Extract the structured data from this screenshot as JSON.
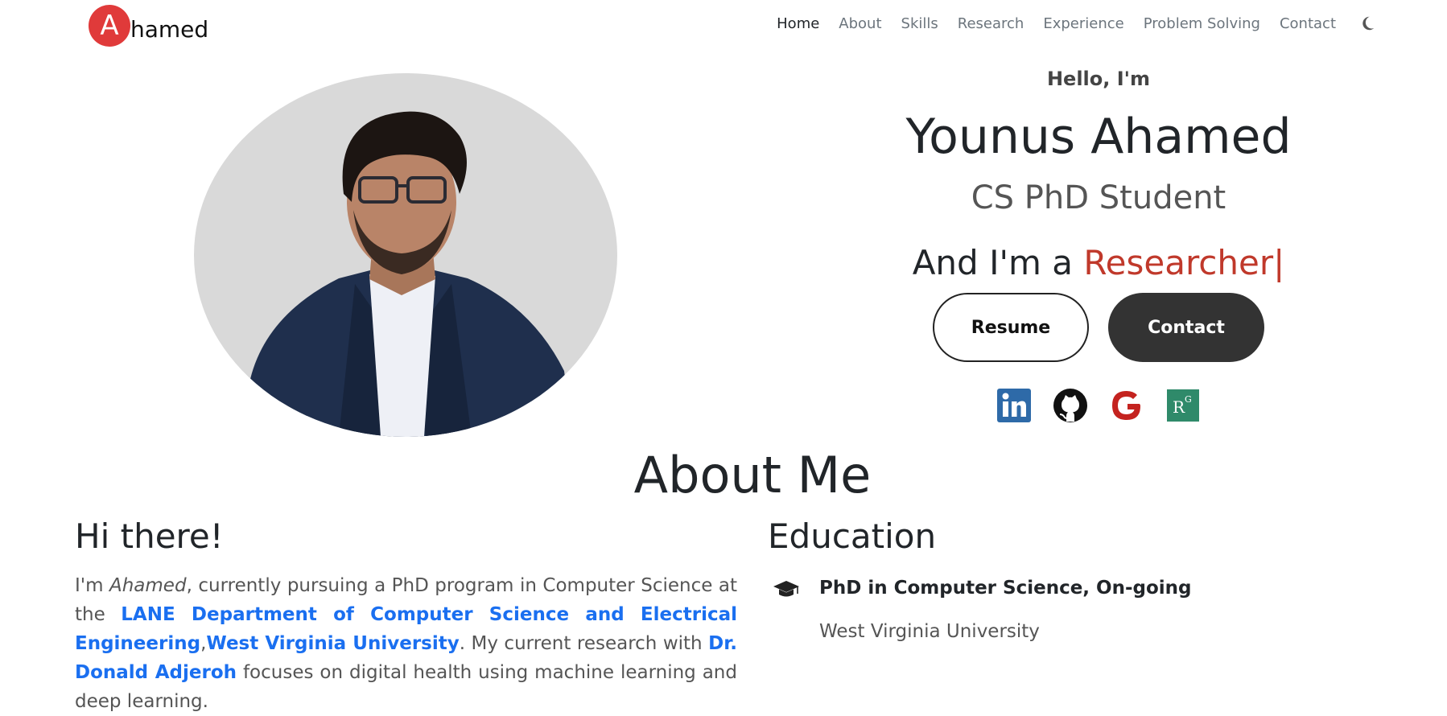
{
  "nav": {
    "brand_initial": "A",
    "brand_text": "hamed",
    "links": [
      "Home",
      "About",
      "Skills",
      "Research",
      "Experience",
      "Problem Solving",
      "Contact"
    ],
    "active": "Home",
    "theme_icon": "moon-icon"
  },
  "hero": {
    "greeting": "Hello, I'm",
    "name": "Younus Ahamed",
    "role": "CS PhD Student",
    "typed_prefix": "And I'm a ",
    "typed_word": "Researcher|",
    "resume_label": "Resume",
    "contact_label": "Contact",
    "socials": [
      "linkedin-icon",
      "github-icon",
      "google-scholar-icon",
      "researchgate-icon"
    ],
    "researchgate_mark": "RG"
  },
  "about": {
    "title": "About Me",
    "hi_heading": "Hi there!",
    "p_im": "I'm ",
    "p_name": "Ahamed",
    "p_1": ", currently pursuing a PhD program in Computer Science at the ",
    "link_dept": "LANE Department of Computer Science and Electrical Engineering",
    "p_comma": ",",
    "link_univ": "West Virginia University",
    "p_2": ". My current research with ",
    "link_advisor": "Dr. Donald Adjeroh",
    "p_3": " focuses on digital health using machine learning and deep learning."
  },
  "education": {
    "heading": "Education",
    "items": [
      {
        "degree": "PhD in Computer Science, On-going",
        "school": "West Virginia University"
      }
    ]
  },
  "colors": {
    "brand_badge": "#e03a3a",
    "accent_word": "#c0392b",
    "link": "#1a6ff0",
    "dark_button": "#333333"
  }
}
